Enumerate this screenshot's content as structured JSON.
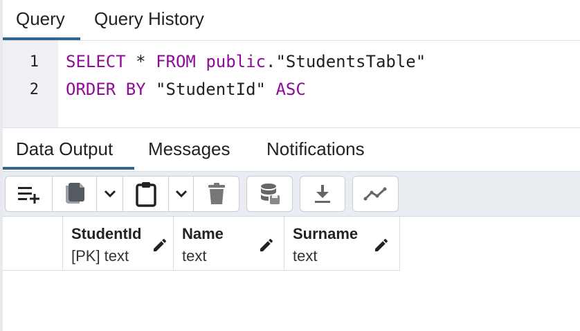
{
  "query_tabs": [
    {
      "label": "Query",
      "active": true
    },
    {
      "label": "Query History",
      "active": false
    }
  ],
  "editor": {
    "lines": [
      {
        "number": "1",
        "tokens": [
          {
            "text": "SELECT",
            "kw": true
          },
          {
            "text": " * ",
            "kw": false
          },
          {
            "text": "FROM",
            "kw": true
          },
          {
            "text": " ",
            "kw": false
          },
          {
            "text": "public",
            "kw": true
          },
          {
            "text": ".\"StudentsTable\"",
            "kw": false
          }
        ]
      },
      {
        "number": "2",
        "tokens": [
          {
            "text": "ORDER BY",
            "kw": true
          },
          {
            "text": " \"StudentId\" ",
            "kw": false
          },
          {
            "text": "ASC",
            "kw": true
          }
        ]
      }
    ],
    "keyword_color": "#8f0c9b"
  },
  "output_tabs": [
    {
      "label": "Data Output",
      "active": true
    },
    {
      "label": "Messages",
      "active": false
    },
    {
      "label": "Notifications",
      "active": false
    }
  ],
  "toolbar": {
    "icons": [
      "add-row-icon",
      "copy-icon",
      "chevron-down-icon",
      "paste-icon",
      "chevron-down-icon",
      "delete-icon",
      "save-data-icon",
      "download-icon",
      "graph-icon"
    ]
  },
  "columns": [
    {
      "name": "StudentId",
      "type": "[PK] text"
    },
    {
      "name": "Name",
      "type": "text"
    },
    {
      "name": "Surname",
      "type": "text"
    }
  ],
  "colors": {
    "accent": "#326690"
  }
}
